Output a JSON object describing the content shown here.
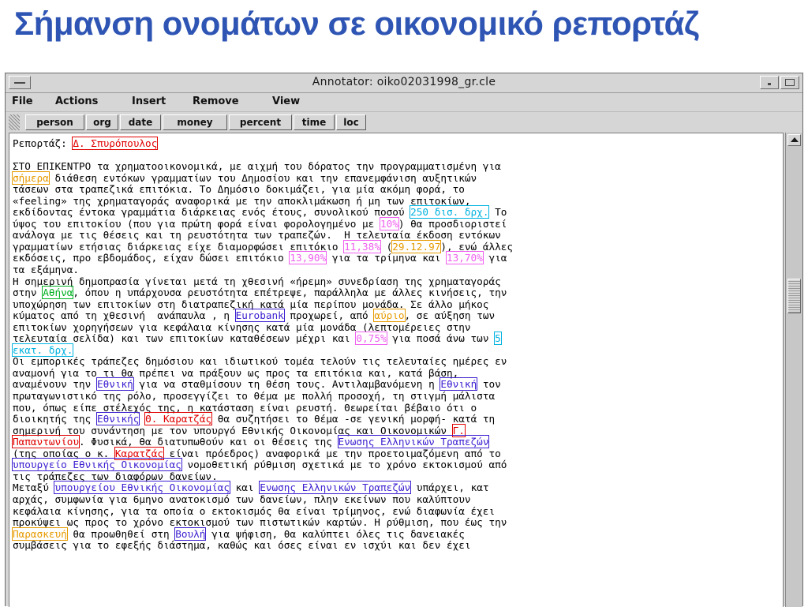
{
  "slide": {
    "title": "Σήμανση ονομάτων σε οικονομικό ρεπορτάζ"
  },
  "window": {
    "title": "Annotator: oiko02031998_gr.cle"
  },
  "menu": [
    "File",
    "Actions",
    "Insert",
    "Remove",
    "View"
  ],
  "toolbar": [
    "person",
    "org",
    "date",
    "money",
    "percent",
    "time",
    "loc"
  ],
  "colors": {
    "title": "#2f55b4",
    "person": "#e00000",
    "org": "#3b1fd0",
    "date": "#e69a00",
    "money": "#00b2e0",
    "percent": "#f060f0",
    "loc": "#00b020"
  },
  "document": {
    "lines": [
      [
        [
          "Ρεπορτάζ: ",
          ""
        ],
        [
          "Δ. Σπυρόπουλος",
          "person"
        ]
      ],
      [],
      [
        [
          "ΣΤΟ ΕΠΙΚΕΝΤΡΟ τα χρηματοοικονομικά, με αιχμή του δόρατος την προγραμματισμένη για",
          ""
        ]
      ],
      [
        [
          "σήμερα",
          "date"
        ],
        [
          " διάθεση εντόκων γραμματίων του Δημοσίου και την επανεμφάνιση αυξητικών",
          ""
        ]
      ],
      [
        [
          "τάσεων στα τραπεζικά επιτόκια. Το Δημόσιο δοκιμάζει, για μία ακόμη φορά, το",
          ""
        ]
      ],
      [
        [
          "«feeling» της χρηματαγοράς αναφορικά με την αποκλιμάκωση ή μη των επιτοκίων,",
          ""
        ]
      ],
      [
        [
          "εκδίδοντας έντοκα γραμμάτια διάρκειας ενός έτους, συνολικού ποσού ",
          ""
        ],
        [
          "250 δισ. δρχ.",
          "money"
        ],
        [
          " Το",
          ""
        ]
      ],
      [
        [
          "ύψος του επιτοκίου (που για πρώτη φορά είναι φορολογημένο με ",
          ""
        ],
        [
          "10%",
          "percent"
        ],
        [
          ") θα προσδιοριστεί",
          ""
        ]
      ],
      [
        [
          "ανάλογα με τις θέσεις και τη ρευστότητα των τραπεζών.  Η τελευταία έκδοση εντόκων",
          ""
        ]
      ],
      [
        [
          "γραμματίων ετήσιας διάρκειας είχε διαμορφώσει επιτόκιο ",
          ""
        ],
        [
          "11,38%",
          "percent"
        ],
        [
          " (",
          ""
        ],
        [
          "29.12.97",
          "date"
        ],
        [
          "), ενώ άλλες",
          ""
        ]
      ],
      [
        [
          "εκδόσεις, προ εβδομάδος, είχαν δώσει επιτόκιο ",
          ""
        ],
        [
          "13,90%",
          "percent"
        ],
        [
          " για τα τρίμηνα και ",
          ""
        ],
        [
          "13,70%",
          "percent"
        ],
        [
          " για",
          ""
        ]
      ],
      [
        [
          "τα εξάμηνα.",
          ""
        ]
      ],
      [
        [
          "Η σημερινή δημοπρασία γίνεται μετά τη χθεσινή «ήρεμη» συνεδρίαση της χρηματαγοράς",
          ""
        ]
      ],
      [
        [
          "στην ",
          ""
        ],
        [
          "Αθήνα",
          "loc"
        ],
        [
          ", όπου η υπάρχουσα ρευστότητα επέτρεψε, παράλληλα με άλλες κινήσεις, την",
          ""
        ]
      ],
      [
        [
          "υποχώρηση των επιτοκίων στη διατραπεζική κατά μία περίπου μονάδα. Σε άλλο μήκος",
          ""
        ]
      ],
      [
        [
          "κύματος από τη χθεσινή  ανάπαυλα , η ",
          ""
        ],
        [
          "Eurobank",
          "org"
        ],
        [
          " προχωρεί, από ",
          ""
        ],
        [
          "αύριο",
          "date"
        ],
        [
          ", σε αύξηση των",
          ""
        ]
      ],
      [
        [
          "επιτοκίων χορηγήσεων για κεφάλαια κίνησης κατά μία μονάδα (λεπτομέρειες στην",
          ""
        ]
      ],
      [
        [
          "τελευταία σελίδα) και των επιτοκίων καταθέσεων μέχρι και ",
          ""
        ],
        [
          "0,75%",
          "percent"
        ],
        [
          " για ποσά άνω των ",
          ""
        ],
        [
          "5",
          "money"
        ]
      ],
      [
        [
          "εκατ. δρχ.",
          "money"
        ]
      ],
      [
        [
          "Οι εμπορικές τράπεζες δημόσιου και ιδιωτικού τομέα τελούν τις τελευταίες ημέρες εν",
          ""
        ]
      ],
      [
        [
          "αναμονή για το τι θα πρέπει να πράξουν ως προς τα επιτόκια και, κατά βάση,",
          ""
        ]
      ],
      [
        [
          "αναμένουν την ",
          ""
        ],
        [
          "Εθνική",
          "org"
        ],
        [
          " για να σταθμίσουν τη θέση τους. Αντιλαμβανόμενη η ",
          ""
        ],
        [
          "Εθνική",
          "org"
        ],
        [
          " τον",
          ""
        ]
      ],
      [
        [
          "πρωταγωνιστικό της ρόλο, προσεγγίζει το θέμα με πολλή προσοχή, τη στιγμή μάλιστα",
          ""
        ]
      ],
      [
        [
          "που, όπως είπε στέλεχός της, η κατάσταση είναι ρευστή. Θεωρείται βέβαιο ότι ο",
          ""
        ]
      ],
      [
        [
          "διοικητής της ",
          ""
        ],
        [
          "Εθνικής",
          "org"
        ],
        [
          " ",
          ""
        ],
        [
          "Θ. Καρατζάς",
          "person"
        ],
        [
          " θα συζητήσει το θέμα -σε γενική μορφή- κατά τη",
          ""
        ]
      ],
      [
        [
          "σημερινή του συνάντηση με τον υπουργό Εθνικής Οικονομίας και Οικονομικών ",
          ""
        ],
        [
          "Γ.",
          "person"
        ]
      ],
      [
        [
          "Παπαντωνίου",
          "person"
        ],
        [
          ". Φυσικά, θα διατυπωθούν και οι θέσεις της ",
          ""
        ],
        [
          "Ενωσης Ελληνικών Τραπεζών",
          "org"
        ]
      ],
      [
        [
          "(της οποίας ο κ. ",
          ""
        ],
        [
          "Καρατζάς",
          "person"
        ],
        [
          " είναι πρόεδρος) αναφορικά με την προετοιμαζόμενη από το",
          ""
        ]
      ],
      [
        [
          "υπουργείο Εθνικής Οικονομίας",
          "org"
        ],
        [
          " νομοθετική ρύθμιση σχετικά με το χρόνο εκτοκισμού από",
          ""
        ]
      ],
      [
        [
          "τις τράπεζες των διαφόρων δανείων.",
          ""
        ]
      ],
      [
        [
          "Μεταξύ ",
          ""
        ],
        [
          "υπουργείου Εθνικής Οικονομίας",
          "org"
        ],
        [
          " και ",
          ""
        ],
        [
          "Ενωσης Ελληνικών Τραπεζών",
          "org"
        ],
        [
          " υπάρχει, κατ",
          ""
        ]
      ],
      [
        [
          "αρχάς, συμφωνία για 6μηνο ανατοκισμό των δανείων, πλην εκείνων που καλύπτουν",
          ""
        ]
      ],
      [
        [
          "κεφάλαια κίνησης, για τα οποία ο εκτοκισμός θα είναι τρίμηνος, ενώ διαφωνία έχει",
          ""
        ]
      ],
      [
        [
          "προκύψει ως προς το χρόνο εκτοκισμού των πιστωτικών καρτών. Η ρύθμιση, που έως την",
          ""
        ]
      ],
      [
        [
          "Παρασκευή",
          "date"
        ],
        [
          " θα προωθηθεί στη ",
          ""
        ],
        [
          "Βουλή",
          "org"
        ],
        [
          " για ψήφιση, θα καλύπτει όλες τις δανειακές",
          ""
        ]
      ],
      [
        [
          "συμβάσεις για το εφεξής διάστημα, καθώς και όσες είναι εν ισχύι και δεν έχει",
          ""
        ]
      ]
    ]
  }
}
